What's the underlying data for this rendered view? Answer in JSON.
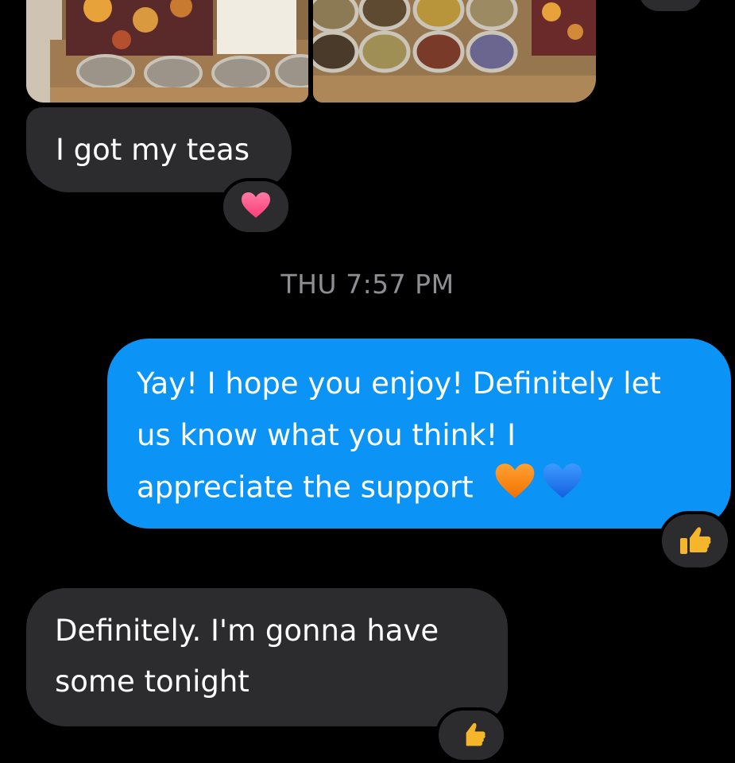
{
  "conversation": {
    "timestamp": "THU 7:57 PM",
    "messages": [
      {
        "direction": "incoming",
        "text": "I got my teas",
        "reaction": "heart-icon"
      },
      {
        "direction": "outgoing",
        "lines": [
          "Yay! I hope you enjoy! Definitely let",
          "us know what you think! I",
          "appreciate the support"
        ],
        "emojis": [
          "orange-heart-icon",
          "blue-heart-icon"
        ],
        "reaction": "thumbs-up-icon"
      },
      {
        "direction": "incoming",
        "lines": [
          "Definitely. I'm gonna have",
          "some tonight"
        ],
        "reaction": "thumbs-up-icon"
      }
    ]
  },
  "colors": {
    "background": "#000000",
    "incoming_bubble": "#2c2c2e",
    "outgoing_bubble": "#0b93f6",
    "timestamp": "#8e8e93",
    "heart": "#ff5f8f",
    "orange_heart": "#ff8c1a",
    "blue_heart": "#1f7fff",
    "thumbs_up": "#f6b62b"
  }
}
